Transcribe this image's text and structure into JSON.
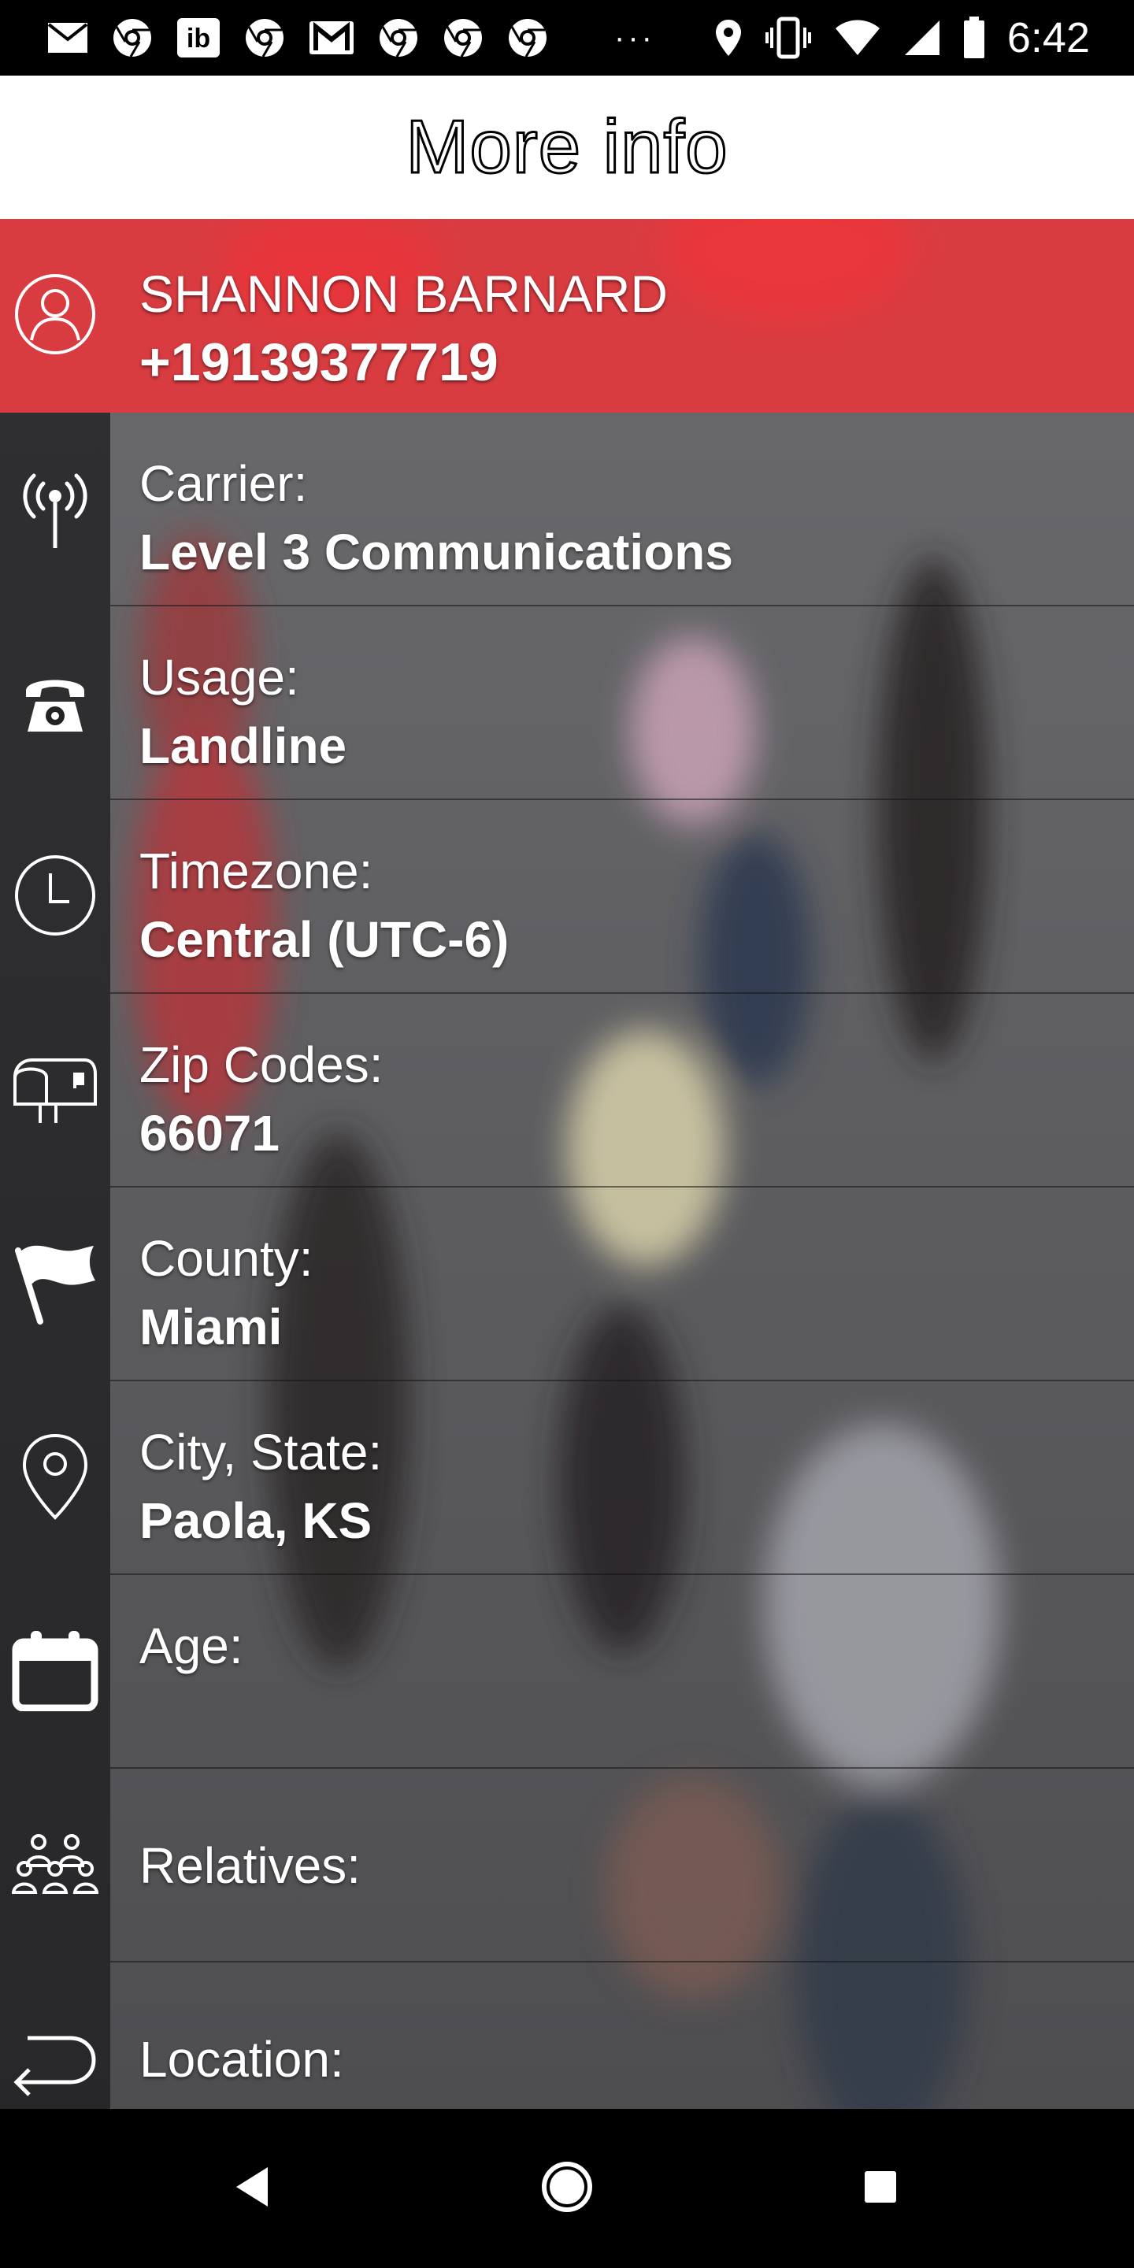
{
  "status_bar": {
    "time": "6:42",
    "left_icons": [
      "mail-icon",
      "chrome-icon",
      "ib-icon",
      "chrome-icon",
      "gmail-icon",
      "chrome-icon",
      "chrome-icon",
      "chrome-icon",
      "more-dots-icon"
    ],
    "ib_text": "ib",
    "more_text": "···",
    "right_icons": [
      "location-pin-icon",
      "vibrate-icon",
      "wifi-icon",
      "cell-signal-icon",
      "battery-icon"
    ]
  },
  "app_bar": {
    "title": "More info"
  },
  "owner": {
    "name": "SHANNON BARNARD",
    "phone": "+19139377719",
    "icon": "person-icon"
  },
  "rows": {
    "carrier": {
      "label": "Carrier:",
      "value": "Level 3 Communications",
      "icon": "antenna-icon"
    },
    "usage": {
      "label": "Usage:",
      "value": "Landline",
      "icon": "telephone-icon"
    },
    "timezone": {
      "label": "Timezone:",
      "value": "Central (UTC-6)",
      "icon": "clock-icon"
    },
    "zip": {
      "label": "Zip Codes:",
      "value": "66071",
      "icon": "mailbox-icon"
    },
    "county": {
      "label": "County:",
      "value": "Miami",
      "icon": "flag-icon"
    },
    "city": {
      "label": "City, State:",
      "value": "Paola, KS",
      "icon": "map-pin-icon"
    },
    "age": {
      "label": "Age:",
      "value": "",
      "icon": "calendar-icon"
    },
    "relatives": {
      "label": "Relatives:",
      "value": "",
      "icon": "people-icon"
    },
    "location": {
      "label": "Location:",
      "value": "",
      "icon": "return-arrow-icon"
    }
  },
  "nav_bar": {
    "buttons": [
      "back-icon",
      "home-icon",
      "recents-icon"
    ]
  },
  "colors": {
    "accent_red": "#f03237",
    "app_bar_bg": "#ffffff",
    "row_icon_bg": "#1e1e22"
  }
}
